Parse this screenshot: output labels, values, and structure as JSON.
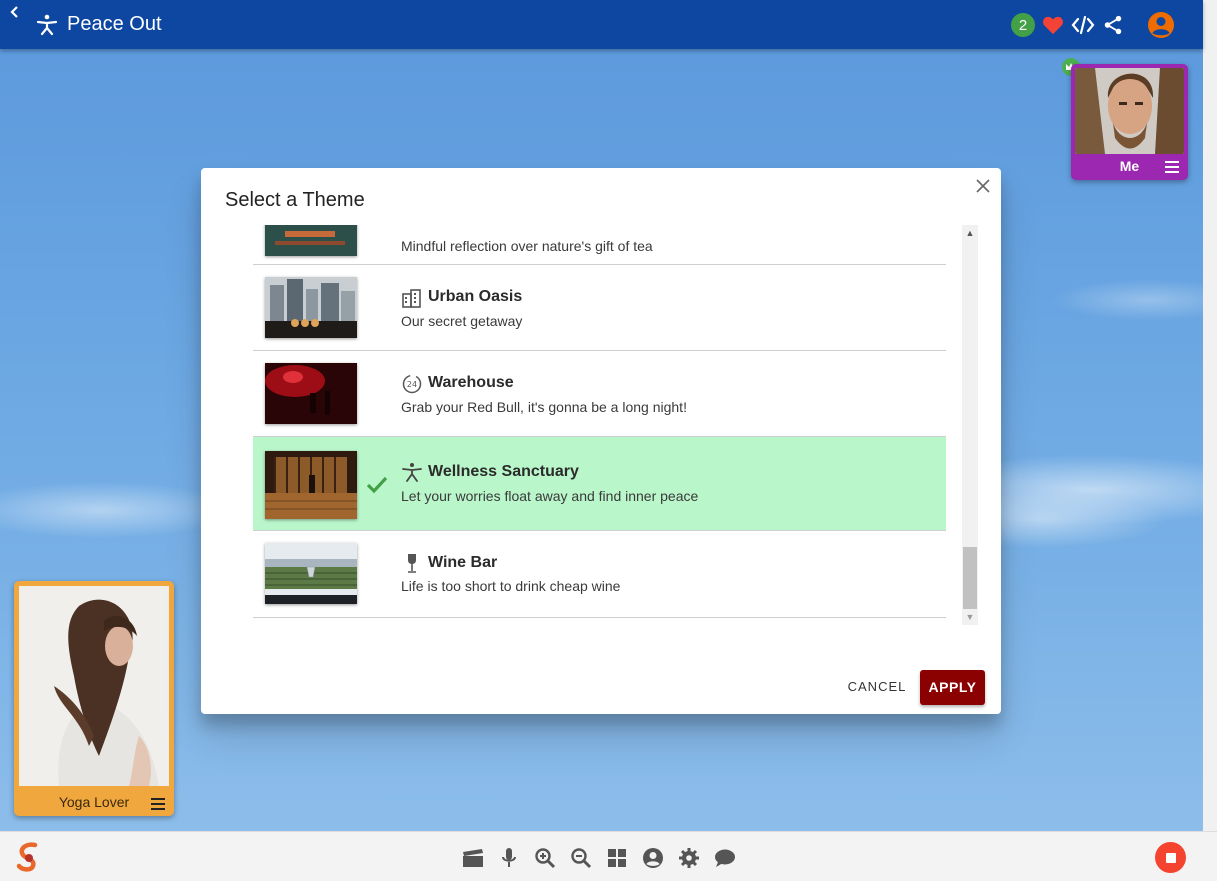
{
  "header": {
    "title": "Peace Out",
    "notification_count": "2"
  },
  "participants": {
    "me": {
      "name": "Me"
    },
    "other": {
      "name": "Yoga Lover"
    }
  },
  "dialog": {
    "title": "Select a Theme",
    "partial_item_desc": "Mindful reflection over nature's gift of tea",
    "themes": [
      {
        "title": "Urban Oasis",
        "description": "Our secret getaway",
        "icon": "building-icon",
        "selected": false
      },
      {
        "title": "Warehouse",
        "description": "Grab your Red Bull, it's gonna be a long night!",
        "icon": "24-hours-icon",
        "selected": false
      },
      {
        "title": "Wellness Sanctuary",
        "description": "Let your worries float away and find inner peace",
        "icon": "meditation-icon",
        "selected": true
      },
      {
        "title": "Wine Bar",
        "description": "Life is too short to drink cheap wine",
        "icon": "wine-glass-icon",
        "selected": false
      }
    ],
    "cancel_label": "CANCEL",
    "apply_label": "APPLY"
  },
  "colors": {
    "header_bg": "#0d47a1",
    "selected_row": "#b9f6ca",
    "apply_button": "#8b0000",
    "me_tile": "#9c27b0",
    "other_tile": "#f0a73d"
  },
  "toolbar_icons": [
    "clapperboard-icon",
    "microphone-icon",
    "zoom-in-icon",
    "zoom-out-icon",
    "grid-icon",
    "account-icon",
    "gear-icon",
    "chat-icon"
  ]
}
